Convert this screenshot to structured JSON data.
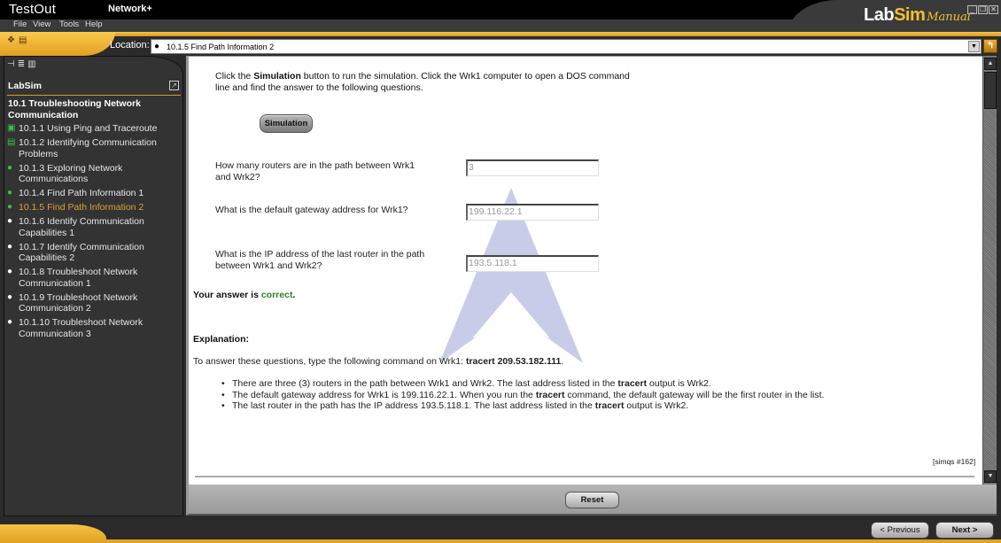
{
  "window": {
    "brand": "TestOut",
    "product": "Network+",
    "logo": {
      "part1": "Lab",
      "part2": "Sim",
      "part3": "Manual"
    },
    "controls": {
      "minimize": "_",
      "restore": "❐",
      "close": "✕"
    }
  },
  "menu": [
    {
      "label": "File",
      "accel": "F"
    },
    {
      "label": "View",
      "accel": "V"
    },
    {
      "label": "Tools",
      "accel": "T"
    },
    {
      "label": "Help",
      "accel": "H"
    }
  ],
  "toolbar": {
    "location_label": "Location:",
    "location_value": "10.1.5 Find Path Information 2"
  },
  "sidebar": {
    "title": "LabSim",
    "section": "10.1 Troubleshooting Network Communication",
    "items": [
      {
        "label": "10.1.1 Using Ping and Traceroute",
        "icon": "video-icon",
        "state": "normal"
      },
      {
        "label": "10.1.2 Identifying Communication Problems",
        "icon": "document-icon",
        "state": "normal"
      },
      {
        "label": "10.1.3 Exploring Network Communications",
        "icon": "lab-done-icon",
        "state": "normal"
      },
      {
        "label": "10.1.4 Find Path Information 1",
        "icon": "lab-done-icon",
        "state": "normal"
      },
      {
        "label": "10.1.5 Find Path Information 2",
        "icon": "lab-done-icon",
        "state": "active"
      },
      {
        "label": "10.1.6 Identify Communication Capabilities 1",
        "icon": "lab-icon",
        "state": "normal"
      },
      {
        "label": "10.1.7 Identify Communication Capabilities 2",
        "icon": "lab-icon",
        "state": "normal"
      },
      {
        "label": "10.1.8 Troubleshoot Network Communication 1",
        "icon": "lab-icon",
        "state": "normal"
      },
      {
        "label": "10.1.9 Troubleshoot Network Communication 2",
        "icon": "lab-icon",
        "state": "normal"
      },
      {
        "label": "10.1.10 Troubleshoot Network Communication 3",
        "icon": "lab-icon",
        "state": "normal"
      }
    ]
  },
  "content": {
    "intro": {
      "pre": "Click the ",
      "bold": "Simulation",
      "post": " button to run the simulation. Click the Wrk1 computer to open a DOS command line and find the answer to the following questions."
    },
    "simulation_button": "Simulation",
    "questions": [
      {
        "text": "How many routers are in the path between Wrk1 and Wrk2?",
        "answer": "3"
      },
      {
        "text": "What is the default gateway address for Wrk1?",
        "answer": "199.116.22.1"
      },
      {
        "text": "What is the IP address of the last router in the path between Wrk1 and Wrk2?",
        "answer": "193.5.118.1"
      }
    ],
    "result": {
      "prefix": "Your answer is ",
      "status": "correct",
      "suffix": "."
    },
    "explanation": {
      "title": "Explanation:",
      "intro_pre": "To answer these questions, type the following command on Wrk1: ",
      "intro_cmd": "tracert 209.53.182.111",
      "intro_post": ".",
      "bullets": [
        {
          "pre": "There are three (3) routers in the path between Wrk1 and Wrk2. The last address listed in the ",
          "bold": "tracert",
          "post": " output is Wrk2."
        },
        {
          "pre": "The default gateway address for Wrk1 is 199.116.22.1. When you run the ",
          "bold": "tracert",
          "post": " command, the default gateway will be the first router in the list."
        },
        {
          "pre": "The last router in the path has the IP address 193.5.118.1. The last address listed in the ",
          "bold": "tracert",
          "post": " output is Wrk2."
        }
      ]
    },
    "reference": "[simqs #162]"
  },
  "buttons": {
    "reset": "Reset",
    "previous": "< Previous",
    "next": "Next >"
  },
  "colors": {
    "accent_gold": "#f2c12e",
    "active_item": "#d9a431",
    "correct": "#2f7d2f"
  }
}
